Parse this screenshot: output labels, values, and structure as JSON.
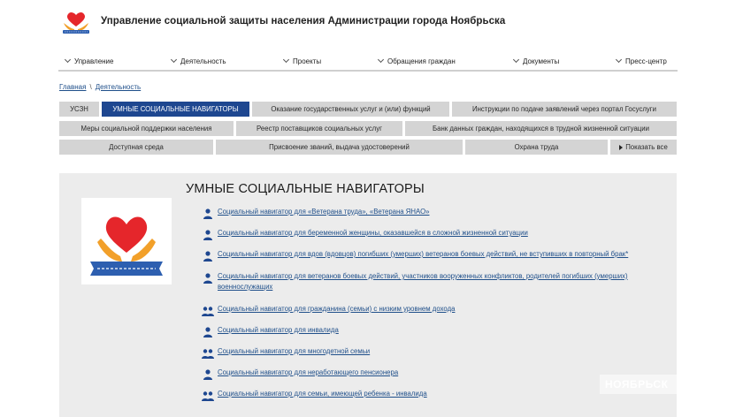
{
  "header": {
    "title": "Управление социальной защиты населения Администрации города Ноябрьска",
    "logo_icon": "heart-hands-logo-icon"
  },
  "nav": {
    "items": [
      {
        "label": "Управление"
      },
      {
        "label": "Деятельность"
      },
      {
        "label": "Проекты"
      },
      {
        "label": "Обращения граждан"
      },
      {
        "label": "Документы"
      },
      {
        "label": "Пресс-центр"
      }
    ]
  },
  "breadcrumb": {
    "home": "Главная",
    "separator": "\\",
    "current": "Деятельность"
  },
  "tabs": [
    {
      "label": "УСЗН"
    },
    {
      "label": "УМНЫЕ СОЦИАЛЬНЫЕ НАВИГАТОРЫ",
      "active": true
    },
    {
      "label": "Оказание государственных услуг и (или) функций"
    },
    {
      "label": "Инструкции по подаче заявлений через портал Госуслуги"
    },
    {
      "label": "Меры социальной поддержки населения"
    },
    {
      "label": "Реестр поставщиков социальных услуг"
    },
    {
      "label": "Банк данных граждан, находящихся в трудной жизненной ситуации"
    },
    {
      "label": "Доступная среда"
    },
    {
      "label": "Присвоение званий, выдача удостоверений"
    },
    {
      "label": "Охрана труда"
    },
    {
      "label": "Показать все"
    }
  ],
  "main": {
    "title": "УМНЫЕ СОЦИАЛЬНЫЕ НАВИГАТОРЫ",
    "links": [
      {
        "label": "Социальный навигатор для «Ветерана труда», «Ветерана ЯНАО»",
        "icon": "person-icon"
      },
      {
        "label": "Социальный навигатор для беременной женщины, оказавшейся в сложной жизненной ситуации",
        "icon": "person-icon"
      },
      {
        "label": "Социальный навигатор для вдов (вдовцов) погибших (умерших) ветеранов боевых действий, не вступивших в повторный брак*",
        "icon": "person-icon"
      },
      {
        "label": "Социальный навигатор для ветеранов боевых действий, участников вооруженных конфликтов, родителей погибших (умерших) военнослужащих",
        "icon": "person-icon"
      },
      {
        "label": "Социальный навигатор для гражданина (семьи) с низким уровнем дохода",
        "icon": "people-icon"
      },
      {
        "label": "Социальный навигатор для инвалида",
        "icon": "person-icon"
      },
      {
        "label": "Социальный навигатор для многодетной семьи",
        "icon": "people-icon"
      },
      {
        "label": "Социальный навигатор для неработающего пенсионера",
        "icon": "person-icon"
      },
      {
        "label": "Социальный навигатор для семьи, имеющей ребенка - инвалида",
        "icon": "people-icon"
      }
    ]
  },
  "watermark": "НОЯБРЬСК",
  "colors": {
    "accent": "#1e4790",
    "tab_bg": "#d4d4d4",
    "panel_bg": "#ececec",
    "link": "#1f4f8a",
    "heart": "#e5262b",
    "hands": "#f2a02a"
  }
}
